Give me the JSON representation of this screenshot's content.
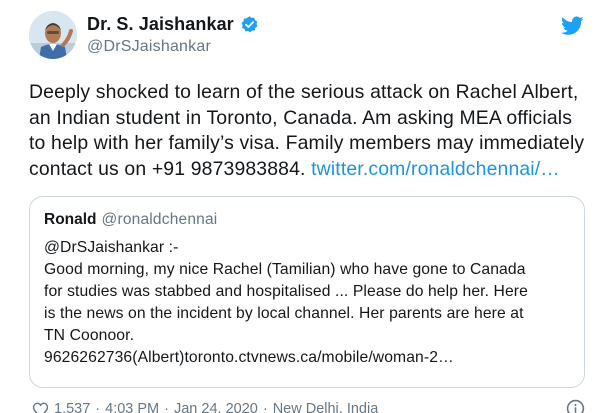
{
  "author": {
    "display_name": "Dr. S. Jaishankar",
    "handle": "@DrSJaishankar",
    "verified": true,
    "avatar_icon": "avatar-photo"
  },
  "brand_icon": "twitter-bird-icon",
  "colors": {
    "link": "#1b95e0",
    "verified": "#1da1f2",
    "muted": "#657786",
    "border": "#ccd6dd"
  },
  "tweet": {
    "lines": [
      "Deeply shocked to learn of the serious attack on Rachel Albert,",
      "an Indian student in Toronto, Canada. Am asking MEA officials",
      "to help with her family’s visa. Family members may immediately",
      "contact us on +91 9873983884."
    ],
    "link": "twitter.com/ronaldchennai/…"
  },
  "quoted": {
    "display_name": "Ronald",
    "handle": "@ronaldchennai",
    "lines": [
      "@DrSJaishankar :-",
      "Good morning, my nice Rachel (Tamilian) who have gone to Canada",
      "for studies was stabbed and hospitalised ... Please do help her. Here",
      "is the news on the incident by local channel. Her parents are here at",
      "TN Coonoor.",
      "9626262736(Albert)toronto.ctvnews.ca/mobile/woman-2…"
    ]
  },
  "footer": {
    "likes": "1,537",
    "time": "4:03 PM",
    "date": "Jan 24, 2020",
    "location": "New Delhi, India",
    "separator": "·"
  }
}
